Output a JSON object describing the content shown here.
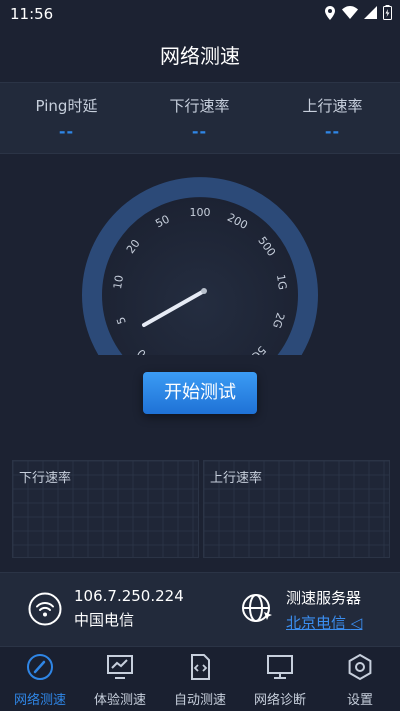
{
  "status": {
    "time": "11:56"
  },
  "title": "网络测速",
  "metrics": [
    {
      "label": "Ping时延",
      "value": "--"
    },
    {
      "label": "下行速率",
      "value": "--"
    },
    {
      "label": "上行速率",
      "value": "--"
    }
  ],
  "gauge": {
    "ticks": [
      "0",
      "5",
      "10",
      "20",
      "50",
      "100",
      "200",
      "500",
      "1G",
      "2G",
      "5G"
    ]
  },
  "start_button": "开始测试",
  "charts": {
    "down_label": "下行速率",
    "up_label": "上行速率"
  },
  "network": {
    "ip": "106.7.250.224",
    "carrier": "中国电信"
  },
  "server": {
    "title": "测速服务器",
    "name": "北京电信"
  },
  "tabs": [
    {
      "label": "网络测速",
      "icon": "speedometer-icon"
    },
    {
      "label": "体验测速",
      "icon": "monitor-chart-icon"
    },
    {
      "label": "自动测速",
      "icon": "code-doc-icon"
    },
    {
      "label": "网络诊断",
      "icon": "monitor-icon"
    },
    {
      "label": "设置",
      "icon": "gear-icon"
    }
  ],
  "colors": {
    "accent": "#2f86e6",
    "background": "#1c2232",
    "panel": "#222a3b"
  }
}
